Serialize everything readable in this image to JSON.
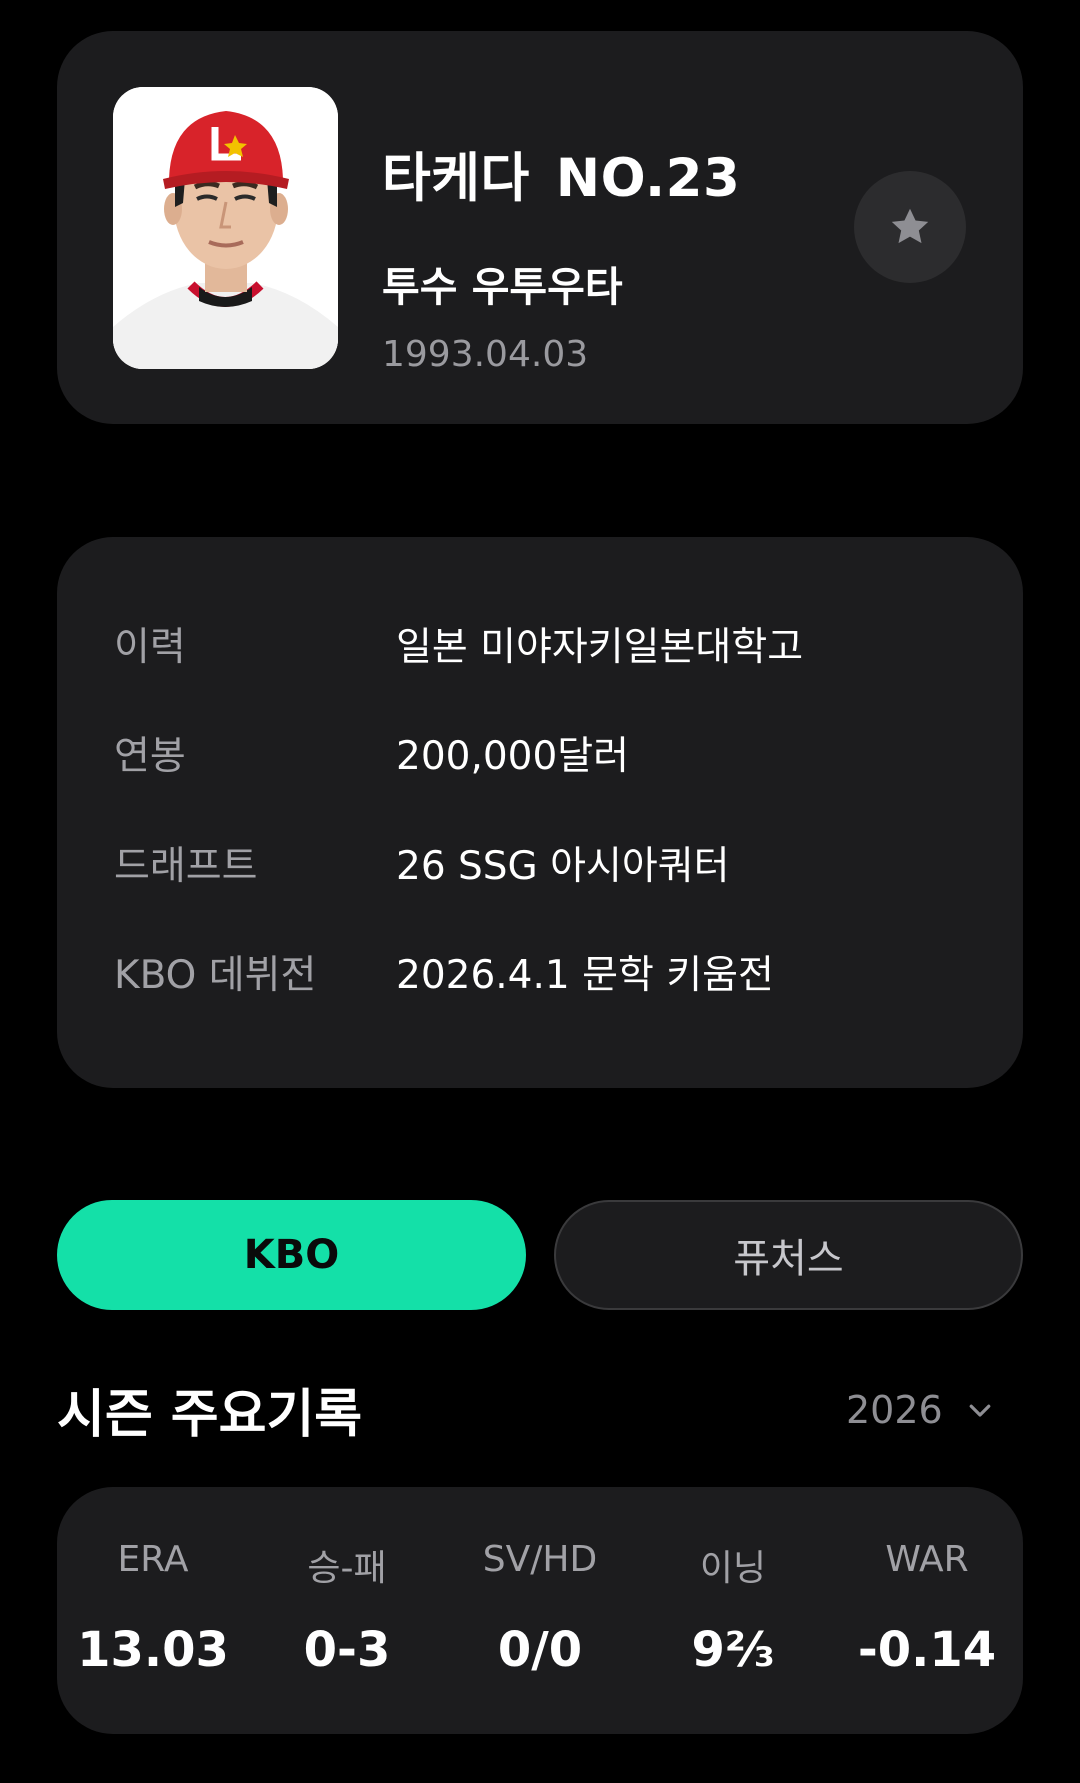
{
  "player": {
    "name": "타케다",
    "number": "NO.23",
    "position": "투수 우투우타",
    "birthdate": "1993.04.03",
    "photo_icon": "player-photo"
  },
  "favorite": {
    "icon": "star-icon"
  },
  "info": {
    "rows": [
      {
        "label": "이력",
        "value": "일본 미야자키일본대학고"
      },
      {
        "label": "연봉",
        "value": "200,000달러"
      },
      {
        "label": "드래프트",
        "value": "26 SSG 아시아쿼터"
      },
      {
        "label": "KBO 데뷔전",
        "value": "2026.4.1 문학 키움전"
      }
    ]
  },
  "tabs": [
    {
      "label": "KBO",
      "active": true
    },
    {
      "label": "퓨처스",
      "active": false
    }
  ],
  "season": {
    "title": "시즌 주요기록",
    "year": "2026",
    "stats": [
      {
        "label": "ERA",
        "value": "13.03"
      },
      {
        "label": "승-패",
        "value": "0-3"
      },
      {
        "label": "SV/HD",
        "value": "0/0"
      },
      {
        "label": "이닝",
        "value": "9⅔"
      },
      {
        "label": "WAR",
        "value": "-0.14"
      }
    ]
  },
  "colors": {
    "background": "#000000",
    "card": "#1c1c1e",
    "accent": "#14e0a8",
    "muted_text": "#a1a1a6"
  }
}
